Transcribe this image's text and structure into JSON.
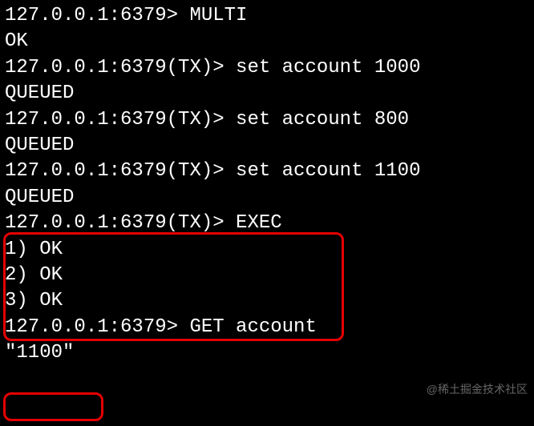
{
  "terminal": {
    "lines": [
      "127.0.0.1:6379> MULTI",
      "OK",
      "127.0.0.1:6379(TX)> set account 1000",
      "QUEUED",
      "127.0.0.1:6379(TX)> set account 800",
      "QUEUED",
      "127.0.0.1:6379(TX)> set account 1100",
      "QUEUED",
      "127.0.0.1:6379(TX)> EXEC",
      "1) OK",
      "2) OK",
      "3) OK",
      "127.0.0.1:6379> GET account",
      "\"1100\""
    ]
  },
  "watermark": "@稀土掘金技术社区"
}
